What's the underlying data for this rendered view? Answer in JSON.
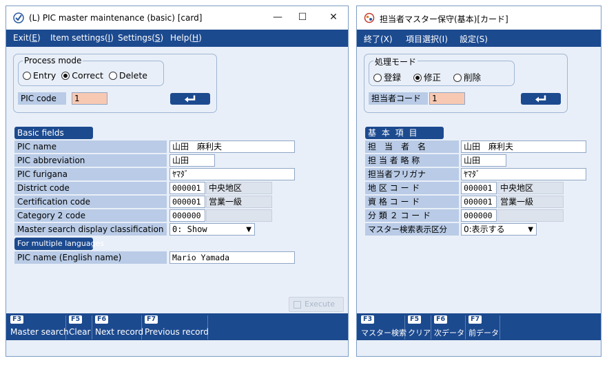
{
  "left": {
    "title": "(L) PIC master maintenance (basic) [card]",
    "menu": [
      {
        "label": "Exit(",
        "key": "E",
        "tail": ")"
      },
      {
        "label": "Item settings(",
        "key": "I",
        "tail": ")"
      },
      {
        "label": "Settings(",
        "key": "S",
        "tail": ")"
      },
      {
        "label": "Help(",
        "key": "H",
        "tail": ")"
      }
    ],
    "process_mode": {
      "legend": "Process mode",
      "options": [
        "Entry",
        "Correct",
        "Delete"
      ],
      "selected": "Correct"
    },
    "pic_code": {
      "label": "PIC code",
      "value": "1"
    },
    "basic_header": "Basic fields",
    "rows": [
      {
        "label": "PIC name",
        "value": "山田　麻利夫"
      },
      {
        "label": "PIC abbreviation",
        "value": "山田"
      },
      {
        "label": "PIC furigana",
        "value": "ﾔﾏﾀﾞ"
      },
      {
        "label": "District code",
        "value": "000001",
        "extra": "中央地区"
      },
      {
        "label": "Certification code",
        "value": "000001",
        "extra": "営業一級"
      },
      {
        "label": "Category 2 code",
        "value": "000000",
        "extra": ""
      },
      {
        "label": "Master search display classification",
        "value": "0: Show"
      }
    ],
    "multi_header": "For multiple languages",
    "english_row": {
      "label": "PIC name (English name)",
      "value": "Mario Yamada"
    },
    "execute_label": "Execute",
    "fkeys": [
      {
        "cap": "F3",
        "name": "Master search"
      },
      {
        "cap": "F5",
        "name": "Clear"
      },
      {
        "cap": "F6",
        "name": "Next record"
      },
      {
        "cap": "F7",
        "name": "Previous record"
      }
    ]
  },
  "right": {
    "title": "担当者マスター保守(基本)[カード]",
    "menu": [
      {
        "label": "終了(X)"
      },
      {
        "label": "項目選択(I)"
      },
      {
        "label": "設定(S)"
      }
    ],
    "process_mode": {
      "legend": "処理モード",
      "options": [
        "登録",
        "修正",
        "削除"
      ],
      "selected": "修正"
    },
    "pic_code": {
      "label": "担当者コード",
      "value": "1"
    },
    "basic_header": "基 本 項 目",
    "rows": [
      {
        "label": "担　当　者　名",
        "value": "山田　麻利夫"
      },
      {
        "label": "担 当 者 略 称",
        "value": "山田"
      },
      {
        "label": "担当者フリガナ",
        "value": "ﾔﾏﾀﾞ"
      },
      {
        "label": "地 区 コ ー ド",
        "value": "000001",
        "extra": "中央地区"
      },
      {
        "label": "資 格 コ ー ド",
        "value": "000001",
        "extra": "営業一級"
      },
      {
        "label": "分 類 ２ コ ー ド",
        "value": "000000",
        "extra": ""
      },
      {
        "label": "マスター検索表示区分",
        "value": "0:表示する"
      }
    ],
    "fkeys": [
      {
        "cap": "F3",
        "name": "マスター検索"
      },
      {
        "cap": "F5",
        "name": "クリア"
      },
      {
        "cap": "F6",
        "name": "次データ"
      },
      {
        "cap": "F7",
        "name": "前データ"
      }
    ]
  },
  "window_controls": {
    "minimize": "—",
    "maximize": "☐",
    "close": "✕"
  },
  "colors": {
    "menubar": "#1c4a8f",
    "label_bg": "#b9cbe6",
    "window_bg": "#e9eff8",
    "code_field": "#f8c9b2"
  }
}
